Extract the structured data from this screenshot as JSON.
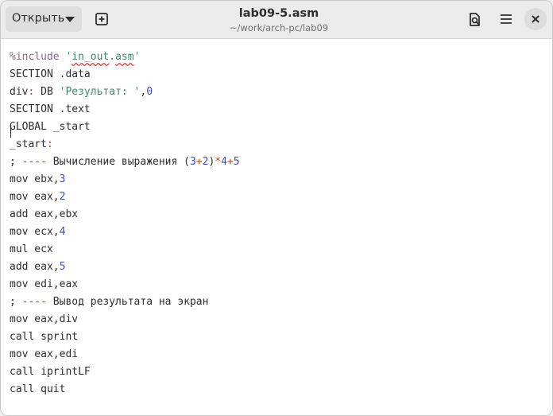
{
  "header": {
    "open_label": "Открыть",
    "title": "lab09-5.asm",
    "subtitle": "~/work/arch-pc/lab09"
  },
  "editor": {
    "lines": [
      {
        "parts": [
          {
            "t": "%include ",
            "c": "pre"
          },
          {
            "t": "'",
            "c": "str"
          },
          {
            "t": "in_out",
            "c": "str sq"
          },
          {
            "t": ".",
            "c": "str"
          },
          {
            "t": "asm",
            "c": "str sq"
          },
          {
            "t": "'",
            "c": "str"
          }
        ]
      },
      {
        "parts": [
          {
            "t": "SECTION .data",
            "c": "kw"
          }
        ]
      },
      {
        "parts": [
          {
            "t": "div",
            "c": "kw"
          },
          {
            "t": ":",
            "c": "op"
          },
          {
            "t": " DB ",
            "c": "kw"
          },
          {
            "t": "'Результат: '",
            "c": "str"
          },
          {
            "t": ",",
            "c": "kw"
          },
          {
            "t": "0",
            "c": "num"
          }
        ]
      },
      {
        "parts": [
          {
            "t": "SECTION .text",
            "c": "kw"
          }
        ]
      },
      {
        "parts": [
          {
            "t": "GLOBAL _start",
            "c": "kw"
          }
        ]
      },
      {
        "parts": [
          {
            "t": "_start",
            "c": "kw"
          },
          {
            "t": ":",
            "c": "op"
          }
        ]
      },
      {
        "parts": [
          {
            "t": "; ",
            "c": "cmt"
          },
          {
            "t": "----",
            "c": "dash"
          },
          {
            "t": " Вычисление выражения (",
            "c": "cmt"
          },
          {
            "t": "3",
            "c": "num"
          },
          {
            "t": "+",
            "c": "op"
          },
          {
            "t": "2",
            "c": "num"
          },
          {
            "t": ")",
            "c": "cmt"
          },
          {
            "t": "*",
            "c": "op"
          },
          {
            "t": "4",
            "c": "num"
          },
          {
            "t": "+",
            "c": "op"
          },
          {
            "t": "5",
            "c": "num"
          }
        ]
      },
      {
        "parts": [
          {
            "t": "mov ebx,",
            "c": "kw"
          },
          {
            "t": "3",
            "c": "num"
          }
        ]
      },
      {
        "parts": [
          {
            "t": "mov eax,",
            "c": "kw"
          },
          {
            "t": "2",
            "c": "num"
          }
        ]
      },
      {
        "parts": [
          {
            "t": "add eax,ebx",
            "c": "kw"
          }
        ]
      },
      {
        "parts": [
          {
            "t": "mov ecx,",
            "c": "kw"
          },
          {
            "t": "4",
            "c": "num"
          }
        ]
      },
      {
        "parts": [
          {
            "t": "mul ecx",
            "c": "kw"
          }
        ]
      },
      {
        "parts": [
          {
            "t": "add eax,",
            "c": "kw"
          },
          {
            "t": "5",
            "c": "num"
          }
        ]
      },
      {
        "parts": [
          {
            "t": "mov edi,eax",
            "c": "kw"
          }
        ]
      },
      {
        "parts": [
          {
            "t": "; ",
            "c": "cmt"
          },
          {
            "t": "----",
            "c": "dash"
          },
          {
            "t": " Вывод результата на экран",
            "c": "cmt"
          }
        ]
      },
      {
        "parts": [
          {
            "t": "mov eax,div",
            "c": "kw"
          }
        ]
      },
      {
        "parts": [
          {
            "t": "call sprint",
            "c": "kw"
          }
        ]
      },
      {
        "parts": [
          {
            "t": "mov eax,edi",
            "c": "kw"
          }
        ]
      },
      {
        "parts": [
          {
            "t": "call iprintLF",
            "c": "kw"
          }
        ]
      },
      {
        "parts": [
          {
            "t": "call quit",
            "c": "kw"
          }
        ]
      }
    ]
  },
  "icons": {
    "new_tab": "new-tab-icon",
    "find": "find-in-file-icon",
    "menu": "hamburger-menu-icon",
    "close": "close-icon"
  }
}
